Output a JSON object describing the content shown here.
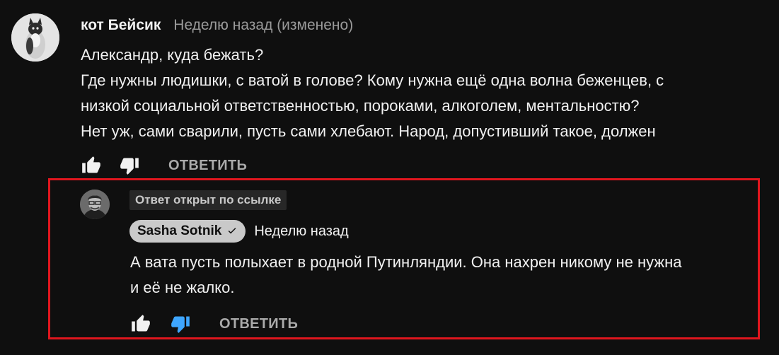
{
  "comment": {
    "author": "кот Бейсик",
    "time": "Неделю назад (изменено)",
    "lines": [
      "Александр, куда бежать?",
      "Где нужны людишки, с ватой в голове? Кому нужна ещё одна волна беженцев, с",
      "низкой социальной ответственностью, пороками, алкоголем, ментальностю?",
      "Нет уж, сами сварили, пусть сами хлебают. Народ, допустивший такое, должен"
    ],
    "reply_label": "ОТВЕТИТЬ"
  },
  "reply": {
    "linked_badge": "Ответ открыт по ссылке",
    "author": "Sasha Sotnik",
    "time": "Неделю назад",
    "lines": [
      "А вата пусть полыхает в родной Путинляндии. Она нахрен никому не нужна",
      "и её не жалко."
    ],
    "reply_label": "ОТВЕТИТЬ",
    "dislike_active": true
  },
  "colors": {
    "background": "#0f0f0f",
    "highlight_border": "#e0161e",
    "active_dislike": "#3ea6ff"
  },
  "icons": {
    "like": "thumbs-up-icon",
    "dislike": "thumbs-down-icon",
    "verified": "checkmark-icon"
  }
}
